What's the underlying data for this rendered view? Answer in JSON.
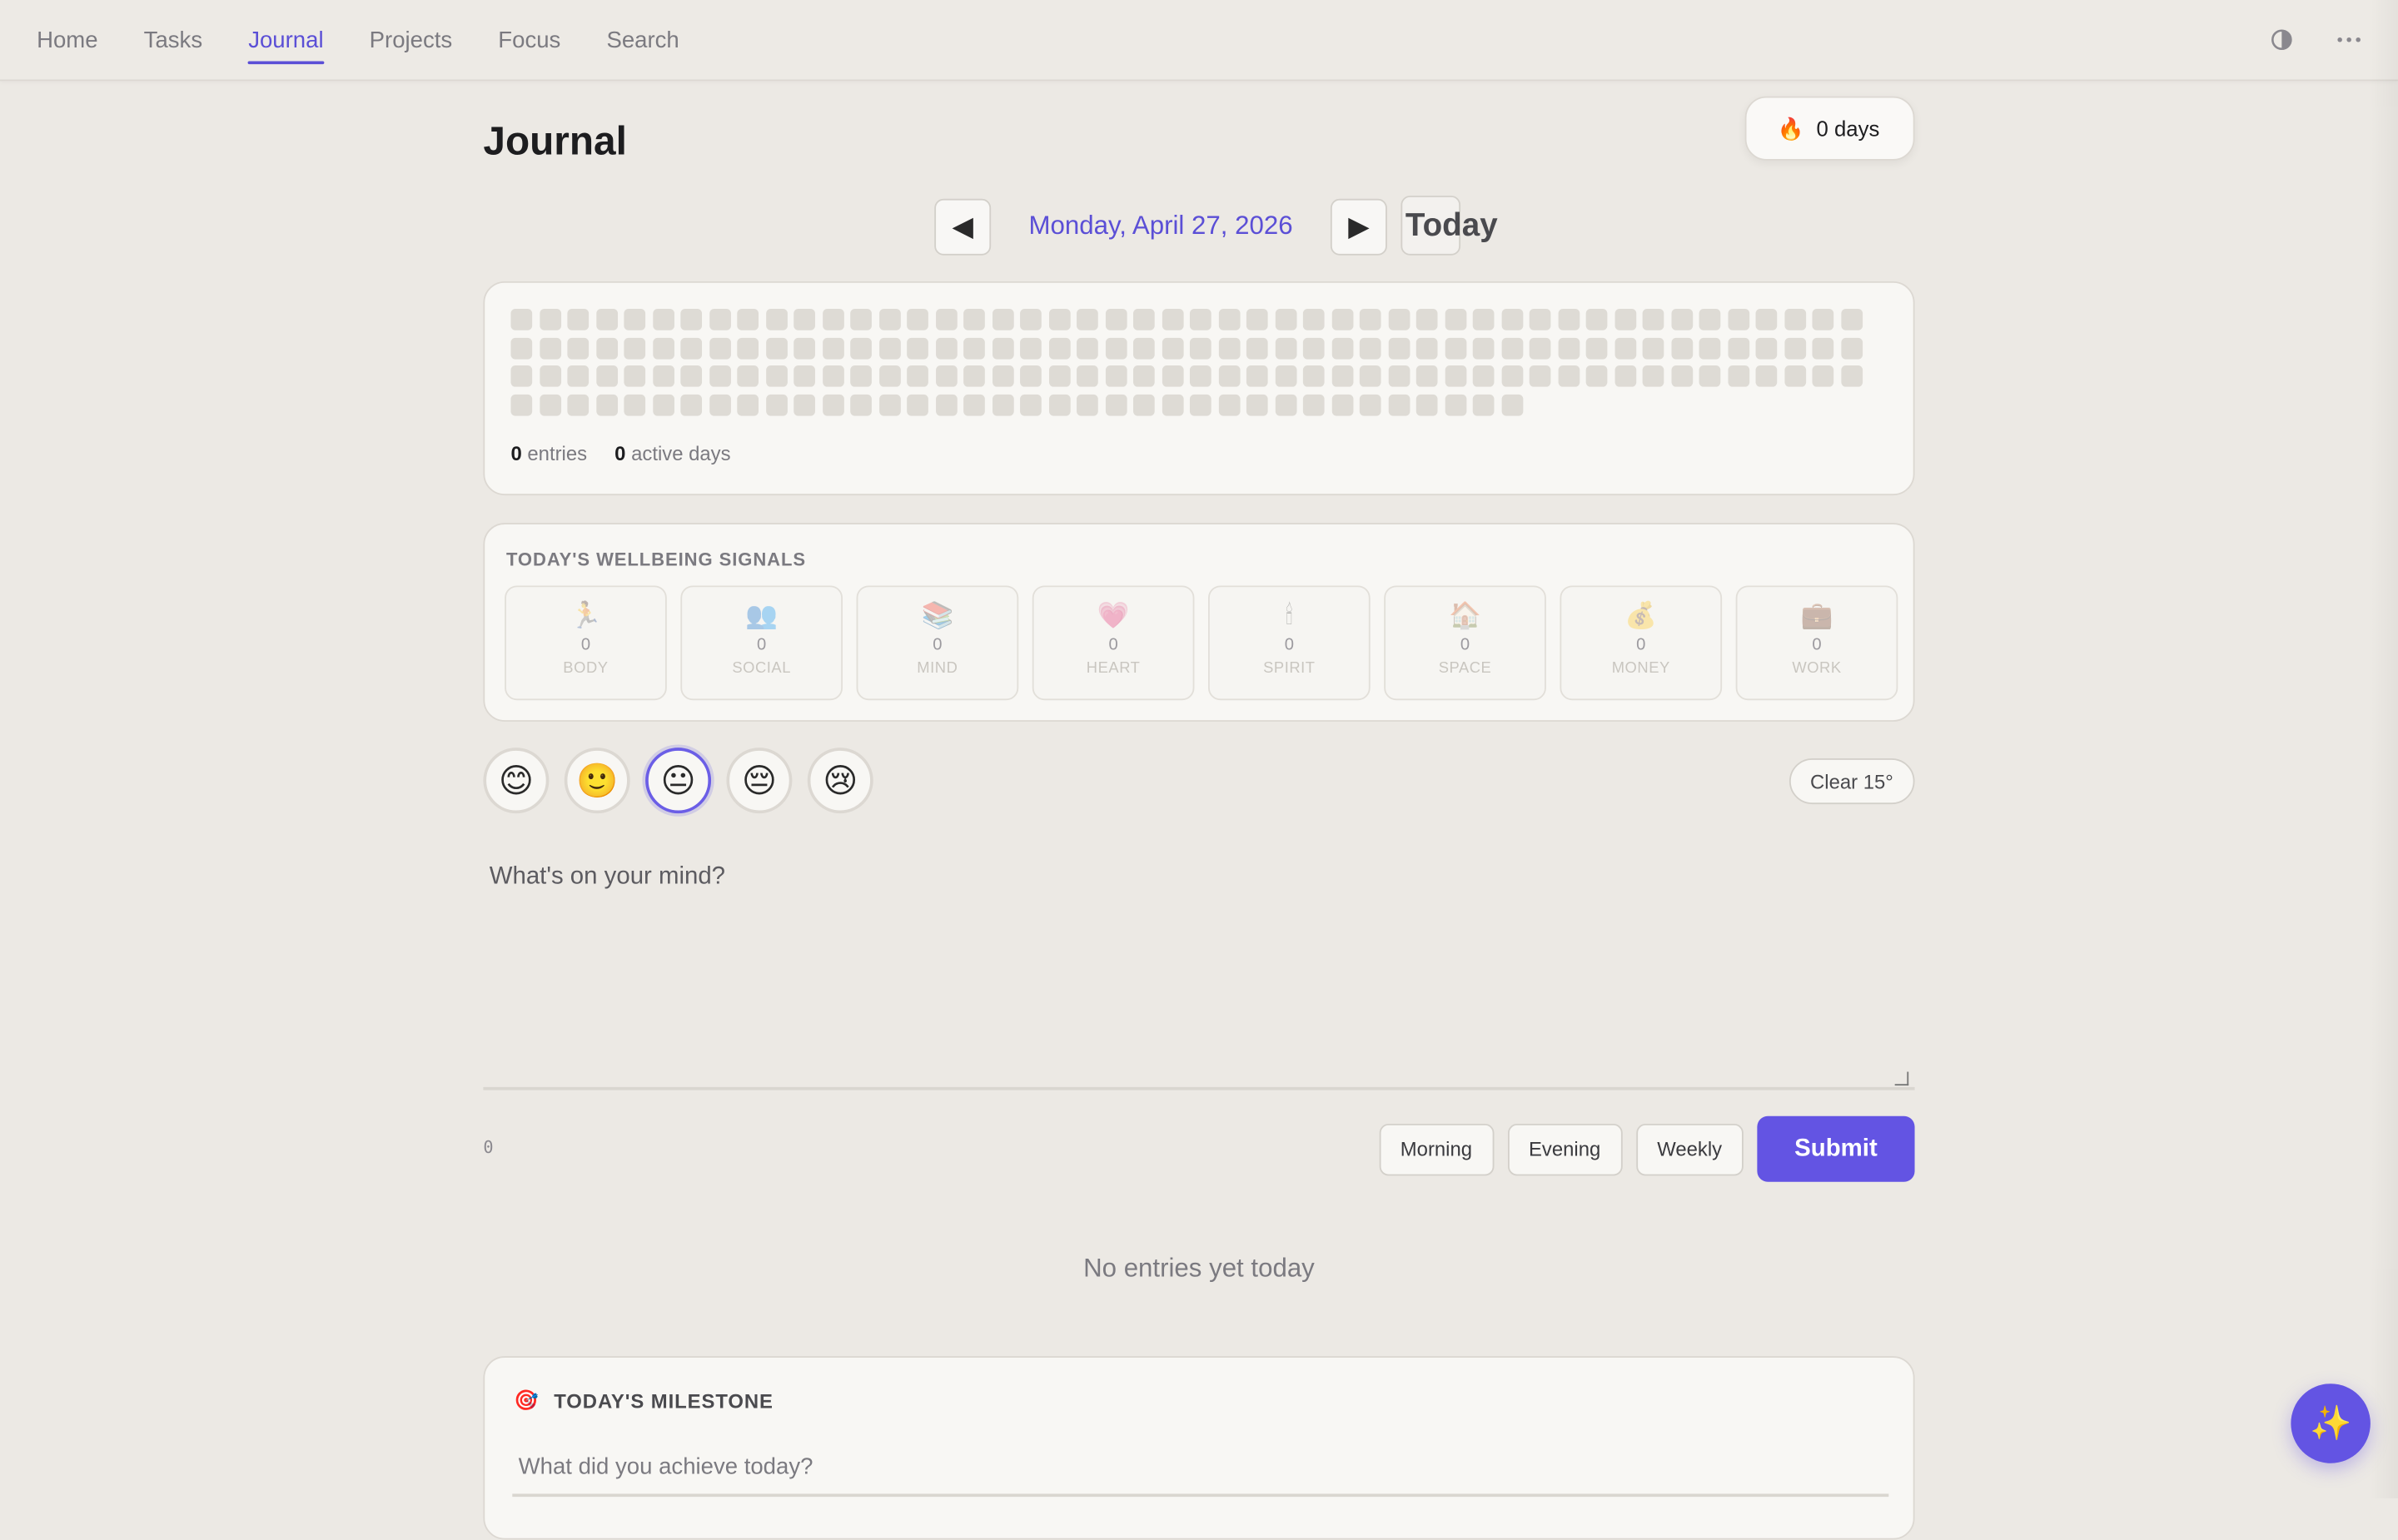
{
  "nav": {
    "links": [
      "Home",
      "Tasks",
      "Journal",
      "Projects",
      "Focus",
      "Search"
    ],
    "active": "Journal"
  },
  "header": {
    "title": "Journal",
    "streak_label": "0 days",
    "streak_icon": "🔥"
  },
  "date_nav": {
    "prev": "◀",
    "date": "Monday, April 27, 2026",
    "next": "▶",
    "today": "Today"
  },
  "heatmap": {
    "entries_count": "0",
    "entries_label": "entries",
    "active_days_count": "0",
    "active_days_label": "active days",
    "total_cells": 180
  },
  "wellbeing": {
    "title": "TODAY'S WELLBEING SIGNALS",
    "signals": [
      {
        "icon": "🏃",
        "value": "0",
        "label": "BODY"
      },
      {
        "icon": "👥",
        "value": "0",
        "label": "SOCIAL"
      },
      {
        "icon": "📚",
        "value": "0",
        "label": "MIND"
      },
      {
        "icon": "💗",
        "value": "0",
        "label": "HEART"
      },
      {
        "icon": "🕯",
        "value": "0",
        "label": "SPIRIT"
      },
      {
        "icon": "🏠",
        "value": "0",
        "label": "SPACE"
      },
      {
        "icon": "💰",
        "value": "0",
        "label": "MONEY"
      },
      {
        "icon": "💼",
        "value": "0",
        "label": "WORK"
      }
    ]
  },
  "moods": [
    "😊",
    "🙂",
    "😐",
    "😔",
    "😢"
  ],
  "selected_mood_index": 2,
  "weather": "Clear 15°",
  "entry": {
    "placeholder": "What's on your mind?",
    "char_count": "0"
  },
  "templates": [
    "Morning",
    "Evening",
    "Weekly"
  ],
  "submit_label": "Submit",
  "empty_message": "No entries yet today",
  "milestone": {
    "icon": "🎯",
    "title": "TODAY'S MILESTONE",
    "placeholder": "What did you achieve today?"
  },
  "fab_icon": "✨",
  "colors": {
    "accent": "#6354e3",
    "background": "#ece9e4",
    "card": "#f8f7f4"
  }
}
